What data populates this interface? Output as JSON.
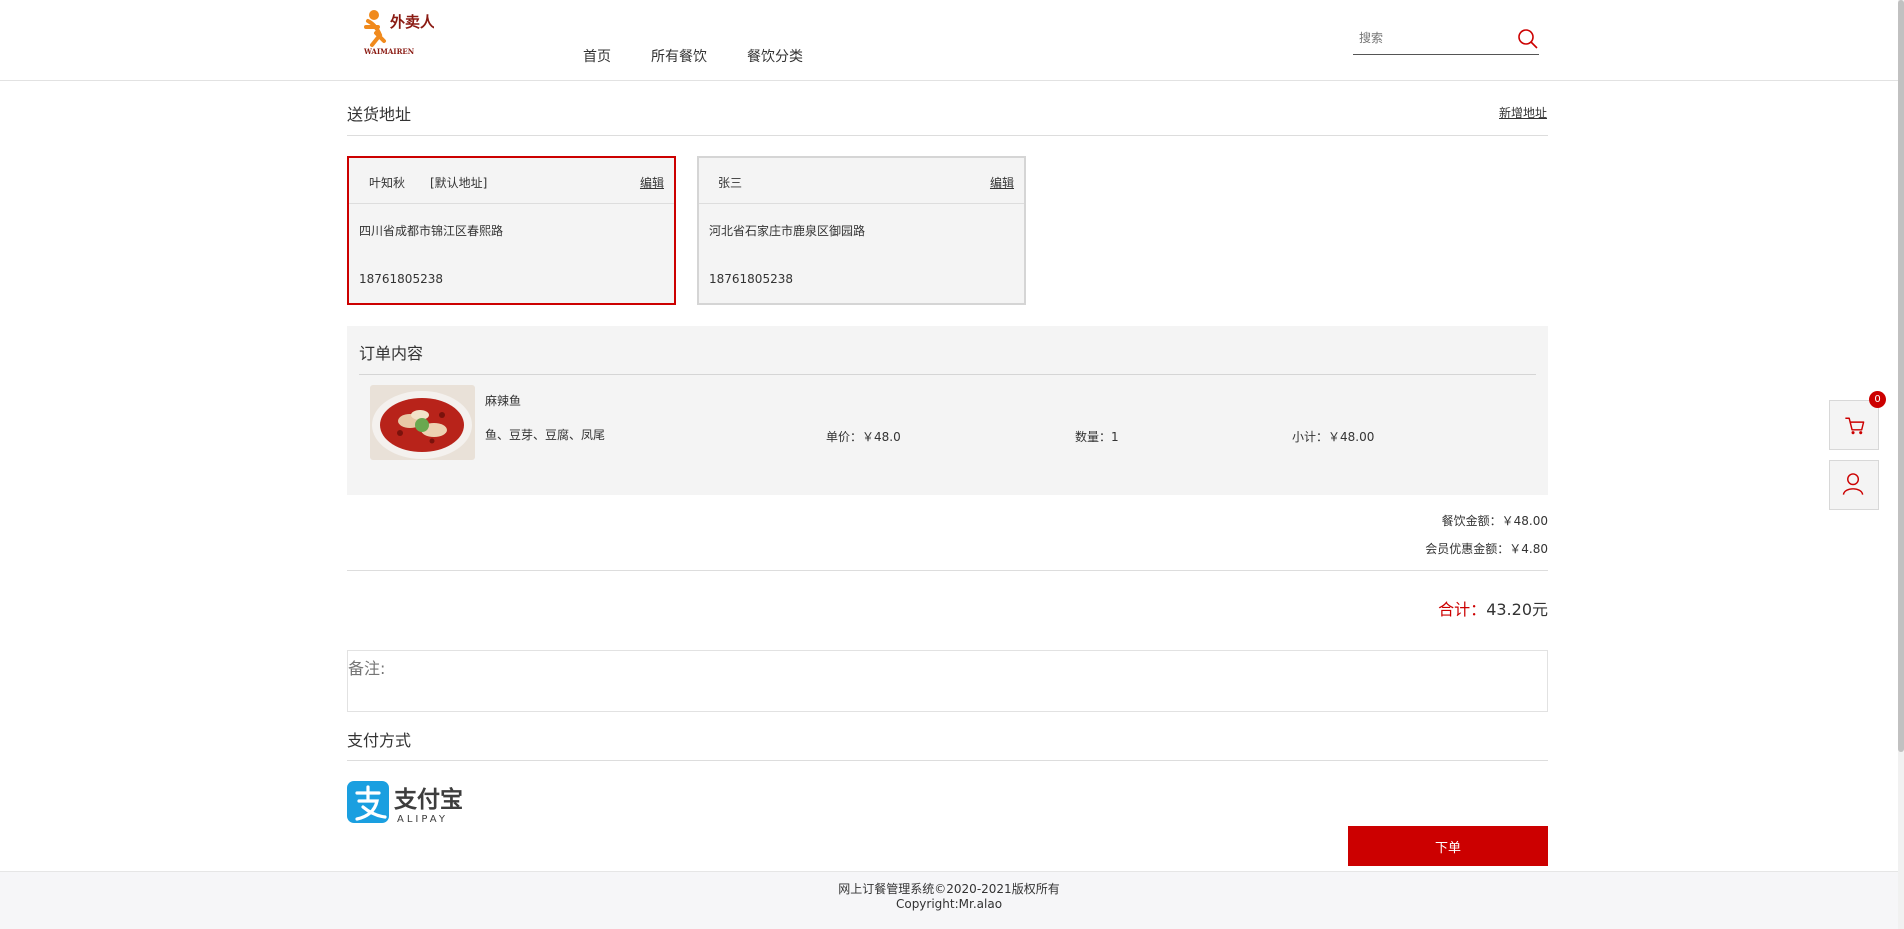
{
  "header": {
    "logo_text_cn": "外卖人",
    "logo_text_en": "WAIMAIREN",
    "nav": [
      {
        "label": "首页"
      },
      {
        "label": "所有餐饮"
      },
      {
        "label": "餐饮分类"
      }
    ],
    "search_placeholder": "搜索"
  },
  "address_section": {
    "title": "送货地址",
    "add_link": "新增地址",
    "cards": [
      {
        "name": "叶知秋",
        "tag": "[默认地址]",
        "edit": "编辑",
        "street": "四川省成都市锦江区春熙路",
        "phone": "18761805238",
        "selected": true
      },
      {
        "name": "张三",
        "tag": "",
        "edit": "编辑",
        "street": "河北省石家庄市鹿泉区御园路",
        "phone": "18761805238",
        "selected": false
      }
    ]
  },
  "order": {
    "title": "订单内容",
    "items": [
      {
        "name": "麻辣鱼",
        "desc": "鱼、豆芽、豆腐、凤尾",
        "price": "单价：￥48.0",
        "qty": "数量：1",
        "subtotal": "小计：￥48.00"
      }
    ]
  },
  "summary": {
    "food_amount": "餐饮金额：￥48.00",
    "member_discount": "会员优惠金额：￥4.80",
    "total_label": "合计：",
    "total_value": "43.20元"
  },
  "remark": {
    "placeholder": "备注:"
  },
  "payment": {
    "title": "支付方式",
    "alipay_cn": "支付宝",
    "alipay_en": "ALIPAY"
  },
  "submit_label": "下单",
  "cart": {
    "count": "0"
  },
  "footer": {
    "line1": "网上订餐管理系统©2020-2021版权所有",
    "line2": "Copyright:Mr.alao"
  },
  "colors": {
    "accent": "#cc0000",
    "panel": "#f4f4f4",
    "alipay": "#1a9fe0"
  }
}
